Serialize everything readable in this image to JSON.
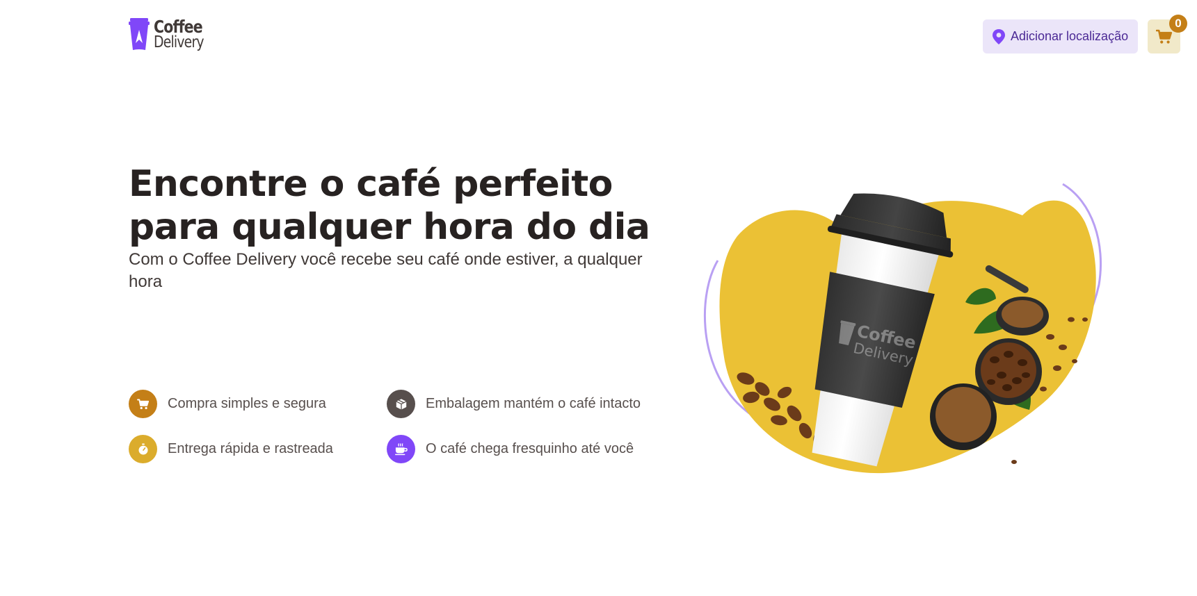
{
  "header": {
    "logo": {
      "line1": "Coffee",
      "line2": "Delivery"
    },
    "location_button": {
      "label": "Adicionar localização",
      "icon": "map-pin-icon"
    },
    "cart": {
      "icon": "shopping-cart-icon",
      "count": "0"
    }
  },
  "hero": {
    "title": "Encontre o café perfeito para qualquer hora do dia",
    "subtitle": "Com o Coffee Delivery você recebe seu café onde estiver, a qualquer hora",
    "features": [
      {
        "label": "Compra simples e segura",
        "icon": "shopping-cart-icon",
        "color": "#C47F17"
      },
      {
        "label": "Embalagem mantém o café intacto",
        "icon": "package-icon",
        "color": "#574F4D"
      },
      {
        "label": "Entrega rápida e rastreada",
        "icon": "timer-icon",
        "color": "#DBAC2C"
      },
      {
        "label": "O café chega fresquinho até você",
        "icon": "coffee-icon",
        "color": "#8047F8"
      }
    ],
    "image": {
      "cup_logo_line1": "Coffee",
      "cup_logo_line2": "Delivery"
    }
  },
  "colors": {
    "purple": "#8047F8",
    "purple_dark": "#4B2995",
    "purple_light": "#EBE5F9",
    "yellow": "#DBAC2C",
    "yellow_dark": "#C47F17",
    "yellow_light": "#F1E9C9",
    "base_text": "#574F4D",
    "base_title": "#272221"
  }
}
